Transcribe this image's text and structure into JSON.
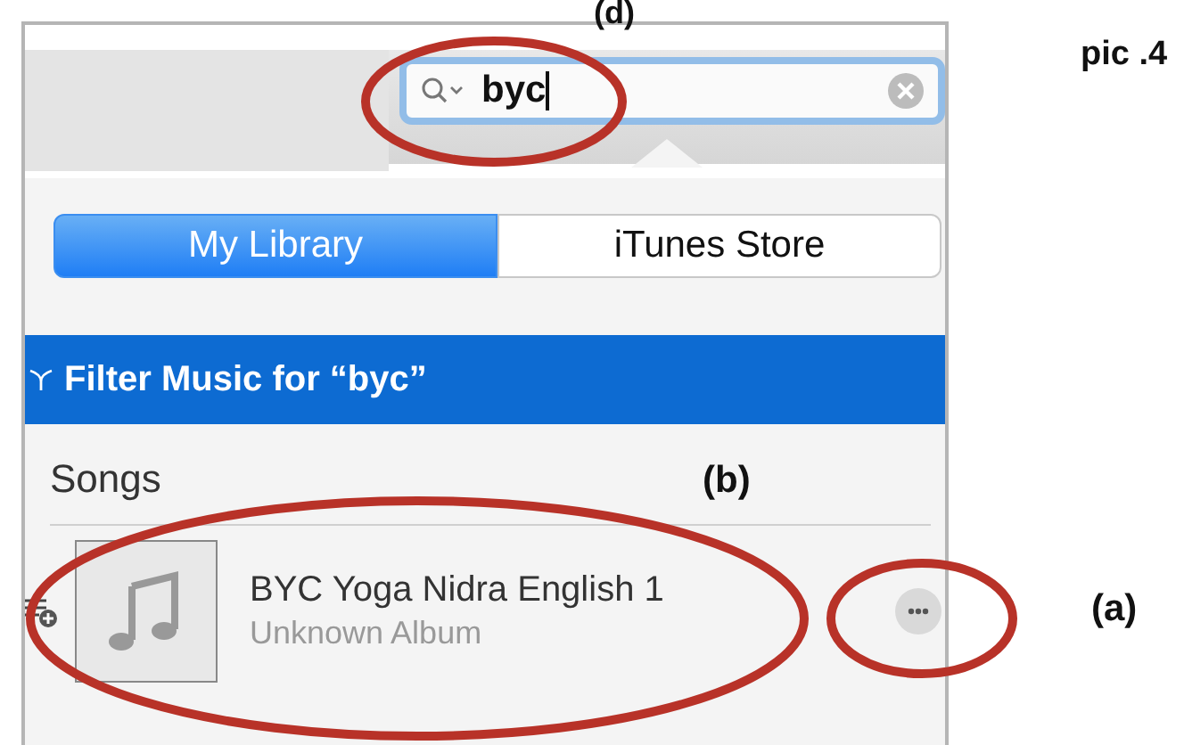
{
  "search": {
    "value": "byc"
  },
  "segments": [
    {
      "label": "My Library",
      "selected": true
    },
    {
      "label": "iTunes Store",
      "selected": false
    }
  ],
  "filter_bar": {
    "label": "Filter Music for “byc”"
  },
  "section": {
    "title": "Songs"
  },
  "songs": [
    {
      "title": "BYC Yoga Nidra English 1",
      "album": "Unknown Album"
    }
  ],
  "annotations": {
    "caption": "pic .4",
    "labels": [
      {
        "text": "(d)"
      },
      {
        "text": "(b)"
      },
      {
        "text": "(a)"
      }
    ]
  }
}
